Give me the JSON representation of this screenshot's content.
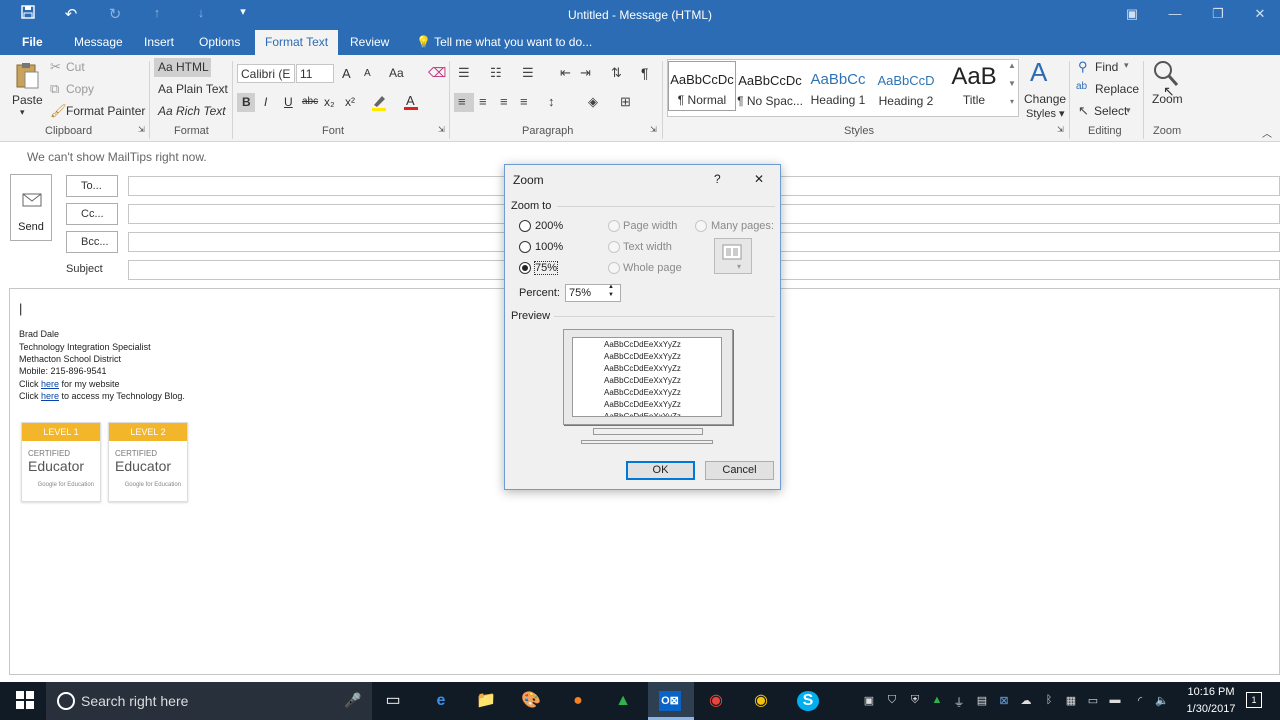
{
  "titlebar": {
    "title": "Untitled - Message (HTML)",
    "icons": [
      "save-icon",
      "undo-icon",
      "redo-icon",
      "up-arrow-icon",
      "down-arrow-icon",
      "customize-icon"
    ],
    "window_controls": [
      "ribbon-display-icon",
      "minimize-icon",
      "restore-icon",
      "close-icon"
    ]
  },
  "tabs": {
    "file": "File",
    "message": "Message",
    "insert": "Insert",
    "options": "Options",
    "format_text": "Format Text",
    "review": "Review",
    "tell_me": "Tell me what you want to do..."
  },
  "ribbon": {
    "clipboard": {
      "paste": "Paste",
      "cut": "Cut",
      "copy": "Copy",
      "format_painter": "Format Painter",
      "label": "Clipboard"
    },
    "format": {
      "html": "Aa HTML",
      "plain": "Aa Plain Text",
      "rich": "Aa Rich Text",
      "label": "Format"
    },
    "font": {
      "family": "Calibri (E",
      "size": "11",
      "label": "Font",
      "bold": "B",
      "italic": "I",
      "underline": "U",
      "strike": "abc",
      "subscript": "x₂",
      "superscript": "x²",
      "grow": "A",
      "shrink": "A",
      "case": "Aa"
    },
    "paragraph": {
      "label": "Paragraph",
      "pilcrow": "¶"
    },
    "styles": {
      "label": "Styles",
      "items": [
        {
          "sample": "AaBbCcDc",
          "name": "¶ Normal"
        },
        {
          "sample": "AaBbCcDc",
          "name": "¶ No Spac..."
        },
        {
          "sample": "AaBbCc",
          "name": "Heading 1"
        },
        {
          "sample": "AaBbCcD",
          "name": "Heading 2"
        },
        {
          "sample": "AaB",
          "name": "Title"
        }
      ],
      "change_styles": "Change Styles",
      "change_styles_l1": "Change",
      "change_styles_l2": "Styles ▾"
    },
    "editing": {
      "find": "Find",
      "replace": "Replace",
      "select": "Select",
      "label": "Editing"
    },
    "zoom": {
      "button": "Zoom",
      "label": "Zoom"
    }
  },
  "message": {
    "mailtips": "We can't show MailTips right now.",
    "send": "Send",
    "to": "To...",
    "cc": "Cc...",
    "bcc": "Bcc...",
    "subject": "Subject",
    "cursor": "|",
    "signature": {
      "name": "Brad Dale",
      "role": "Technology Integration Specialist",
      "org": "Methacton School District",
      "mobile": "Mobile: 215-896-9541",
      "line1_pre": "Click ",
      "line1_link": "here",
      "line1_post": " for my website",
      "line2_pre": "Click ",
      "line2_link": "here",
      "line2_post": " to access my Technology Blog."
    },
    "badges": [
      {
        "level": "LEVEL 1",
        "certified": "CERTIFIED",
        "title": "Educator",
        "brand": "Google for Education"
      },
      {
        "level": "LEVEL 2",
        "certified": "CERTIFIED",
        "title": "Educator",
        "brand": "Google for Education"
      }
    ]
  },
  "dialog": {
    "title": "Zoom",
    "help": "?",
    "close": "✕",
    "zoom_to": "Zoom to",
    "opt_200": "200%",
    "opt_100": "100%",
    "opt_75": "75%",
    "page_width": "Page width",
    "text_width": "Text width",
    "whole_page": "Whole page",
    "many_pages": "Many pages:",
    "percent_label": "Percent:",
    "percent_value": "75%",
    "preview": "Preview",
    "preview_text": "AaBbCcDdEeXxYyZz",
    "ok": "OK",
    "cancel": "Cancel",
    "selected": "75%"
  },
  "taskbar": {
    "search": "Search right here",
    "time": "10:16 PM",
    "date": "1/30/2017",
    "notifications": "1"
  },
  "colors": {
    "accent": "#2b6cb5",
    "badge": "#f3b62a",
    "taskbar": "#101b26"
  }
}
